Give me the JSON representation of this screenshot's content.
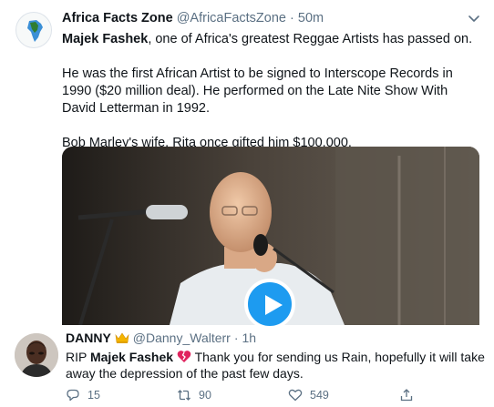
{
  "tweet1": {
    "name": "Africa Facts Zone",
    "handle": "@AfricaFactsZone",
    "separator": "·",
    "time": "50m",
    "lead_bold": "Majek Fashek",
    "lead_rest": ", one of Africa's greatest Reggae Artists has passed on.",
    "paragraph2": "He was the first African Artist to be signed to Interscope Records in 1990 ($20 million deal). He performed on the Late Nite Show With David Letterman in 1992.",
    "paragraph3": "Bob Marley's wife, Rita once gifted him $100,000.",
    "avatar_icon": "africa-map-icon",
    "more_icon": "chevron-down-icon"
  },
  "video": {
    "play_icon": "play-icon"
  },
  "tweet2": {
    "name": "DANNY",
    "crown_icon": "crown-icon",
    "handle": "@Danny_Walterr",
    "separator": "·",
    "time": "1h",
    "text_prefix": "RIP ",
    "text_bold": "Majek Fashek",
    "heart_icon": "broken-heart-icon",
    "text_rest": " Thank you for sending us Rain, hopefully it will take away the depression of the past few days.",
    "actions": {
      "reply_count": "15",
      "retweet_count": "90",
      "like_count": "549"
    }
  },
  "colors": {
    "accent": "#1d9bf0",
    "muted": "#5b7083",
    "heart": "#e0245e",
    "crown": "#f4b400"
  }
}
